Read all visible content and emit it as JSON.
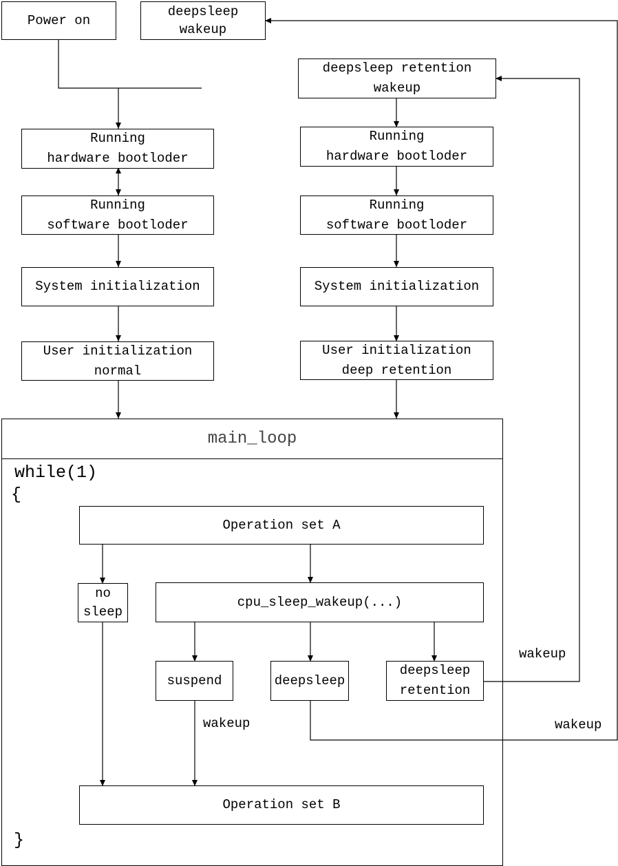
{
  "top": {
    "power_on": "Power on",
    "deepsleep_wakeup": [
      "deepsleep",
      "wakeup"
    ],
    "deepsleep_retention_wakeup": [
      "deepsleep retention",
      "wakeup"
    ]
  },
  "left_column": {
    "hw_boot": [
      "Running",
      "hardware bootloder"
    ],
    "sw_boot": [
      "Running",
      "software bootloder"
    ],
    "sys_init": "System initialization",
    "user_init": [
      "User initialization",
      "normal"
    ]
  },
  "right_column": {
    "hw_boot": [
      "Running",
      "hardware bootloder"
    ],
    "sw_boot": [
      "Running",
      "software bootloder"
    ],
    "sys_init": "System initialization",
    "user_init": [
      "User initialization",
      "deep retention"
    ]
  },
  "main_loop": {
    "title": "main_loop",
    "while": "while(1)",
    "open_brace": "{",
    "close_brace": "}",
    "op_a": "Operation set A",
    "no_sleep": [
      "no",
      "sleep"
    ],
    "cpu_sleep": "cpu_sleep_wakeup(...)",
    "suspend": "suspend",
    "deepsleep": "deepsleep",
    "deepsleep_retention": [
      "deepsleep",
      "retention"
    ],
    "op_b": "Operation set B",
    "suspend_wakeup": "wakeup"
  },
  "edges": {
    "retention_wakeup": "wakeup",
    "deepsleep_wakeup": "wakeup"
  }
}
